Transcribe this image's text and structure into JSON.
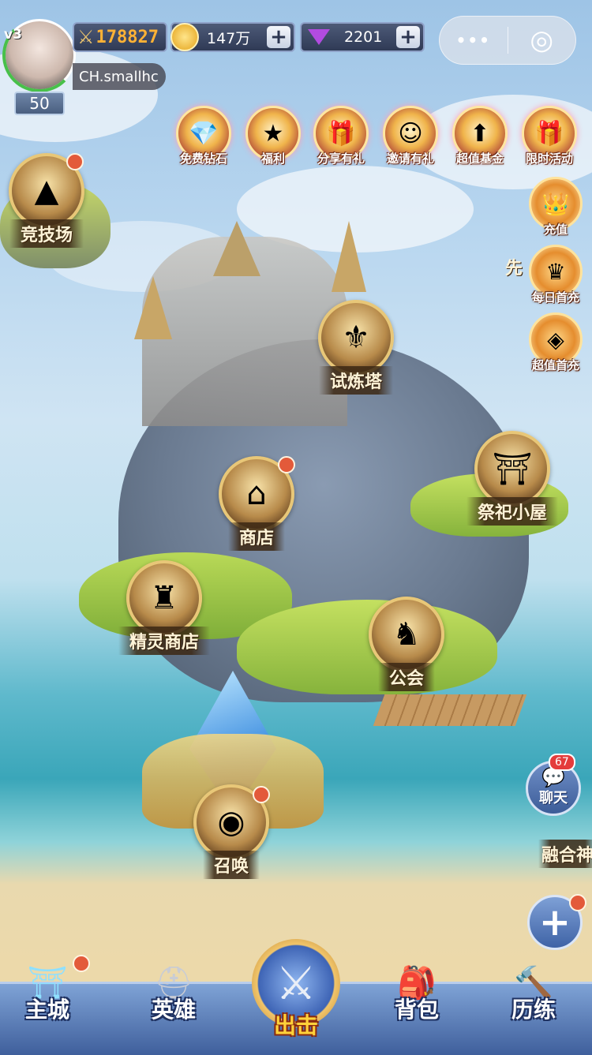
{
  "hud": {
    "vip_level": "v3",
    "player_name": "CH.smallhc",
    "player_level": "50",
    "combat_power": "178827",
    "gold": "147万",
    "diamonds": "2201",
    "plus": "+"
  },
  "system_buttons": {
    "more": "•••",
    "close": "◎"
  },
  "events": [
    {
      "label": "免费钻石",
      "icon": "gem-icon"
    },
    {
      "label": "福利",
      "icon": "star-medal-icon"
    },
    {
      "label": "分享有礼",
      "icon": "gift-icon"
    },
    {
      "label": "邀请有礼",
      "icon": "friends-icon"
    },
    {
      "label": "超值基金",
      "icon": "fund-icon"
    },
    {
      "label": "限时活动",
      "icon": "limited-gift-icon"
    }
  ],
  "right_column": [
    {
      "label": "充值",
      "icon": "recharge-chest-icon"
    },
    {
      "label": "每日首充",
      "icon": "daily-recharge-icon"
    },
    {
      "label": "超值首充",
      "icon": "first-recharge-chest-icon"
    }
  ],
  "partial_building": "先",
  "buildings": {
    "arena": "竞技场",
    "trial_tower": "试炼塔",
    "shop": "商店",
    "altar_hut": "祭祀小屋",
    "spirit_shop": "精灵商店",
    "guild": "公会",
    "summon": "召唤",
    "fusion": "融合神"
  },
  "chat": {
    "label": "聊天",
    "badge": "67"
  },
  "float_plus": "+",
  "nav": [
    {
      "label": "主城",
      "icon": "castle-portal-icon"
    },
    {
      "label": "英雄",
      "icon": "knight-helmet-icon"
    },
    {
      "label": "出击",
      "icon": "crossed-swords-icon"
    },
    {
      "label": "背包",
      "icon": "backpack-icon"
    },
    {
      "label": "历练",
      "icon": "hammer-icon"
    }
  ]
}
